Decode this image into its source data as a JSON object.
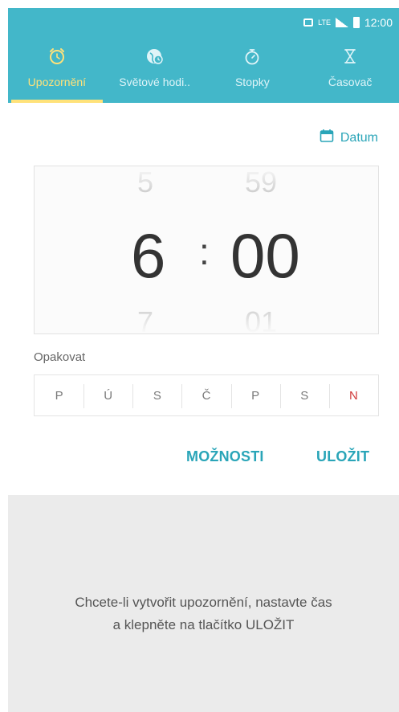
{
  "status_bar": {
    "time": "12:00",
    "icons": [
      "nfc-icon",
      "lte-icon",
      "signal-icon",
      "battery-icon"
    ],
    "lte_text": "LTE"
  },
  "tabs": [
    {
      "label": "Upozornění",
      "icon": "alarm-clock-icon",
      "active": true
    },
    {
      "label": "Světové hodi..",
      "icon": "world-clock-icon",
      "active": false
    },
    {
      "label": "Stopky",
      "icon": "stopwatch-icon",
      "active": false
    },
    {
      "label": "Časovač",
      "icon": "hourglass-icon",
      "active": false
    }
  ],
  "date_button": {
    "label": "Datum",
    "icon": "calendar-icon"
  },
  "time_picker": {
    "hour_prev": "5",
    "hour": "6",
    "hour_next": "7",
    "separator": ":",
    "minute_prev": "59",
    "minute": "00",
    "minute_next": "01"
  },
  "repeat": {
    "label": "Opakovat",
    "days": [
      "P",
      "Ú",
      "S",
      "Č",
      "P",
      "S",
      "N"
    ]
  },
  "actions": {
    "options_label": "MOŽNOSTI",
    "save_label": "ULOŽIT"
  },
  "hint": {
    "line1": "Chcete-li vytvořit upozornění, nastavte čas",
    "line2": "a klepněte na tlačítko ULOŽIT"
  },
  "colors": {
    "accent": "#43b7c9",
    "active_tab": "#ffe27a",
    "sunday": "#d03a3a",
    "action_text": "#2aa5b8"
  }
}
